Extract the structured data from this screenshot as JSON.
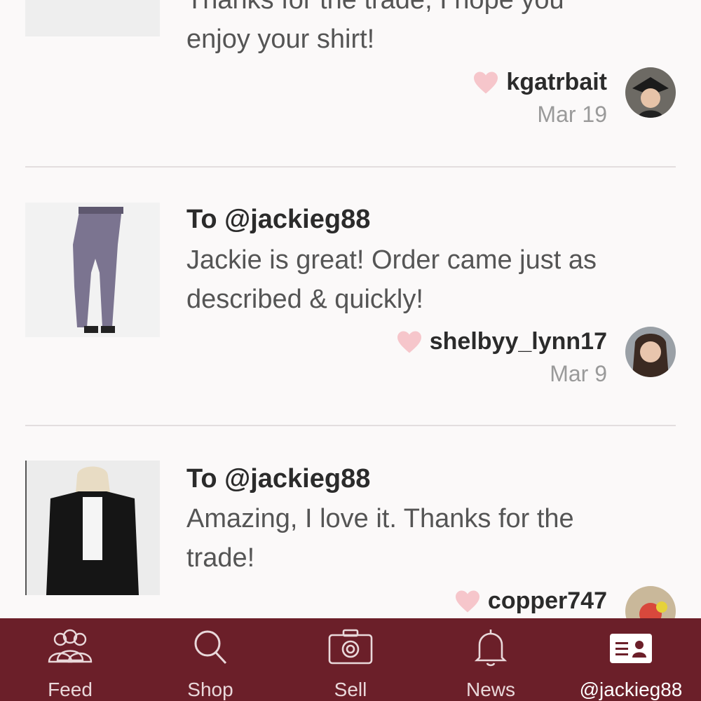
{
  "reviews": [
    {
      "to": "",
      "text_lines": [
        "Thanks for the trade, I hope you",
        "enjoy your shirt!"
      ],
      "username": "kgatrbait",
      "date": "Mar 19"
    },
    {
      "to": "To @jackieg88",
      "text_lines": [
        "Jackie is great! Order came just as",
        "described & quickly!"
      ],
      "username": "shelbyy_lynn17",
      "date": "Mar 9"
    },
    {
      "to": "To @jackieg88",
      "text_lines": [
        "Amazing, I love it. Thanks for the",
        "trade!"
      ],
      "username": "copper747",
      "date": ""
    }
  ],
  "tabbar": {
    "items": [
      {
        "label": "Feed",
        "icon": "people-icon"
      },
      {
        "label": "Shop",
        "icon": "search-icon"
      },
      {
        "label": "Sell",
        "icon": "camera-icon"
      },
      {
        "label": "News",
        "icon": "bell-icon"
      },
      {
        "label": "@jackieg88",
        "icon": "profile-card-icon",
        "active": true
      }
    ]
  },
  "colors": {
    "background": "#fbf9f9",
    "tabbar": "#6b1f29",
    "heart": "#f6c6cb",
    "divider": "#e3dedf"
  }
}
